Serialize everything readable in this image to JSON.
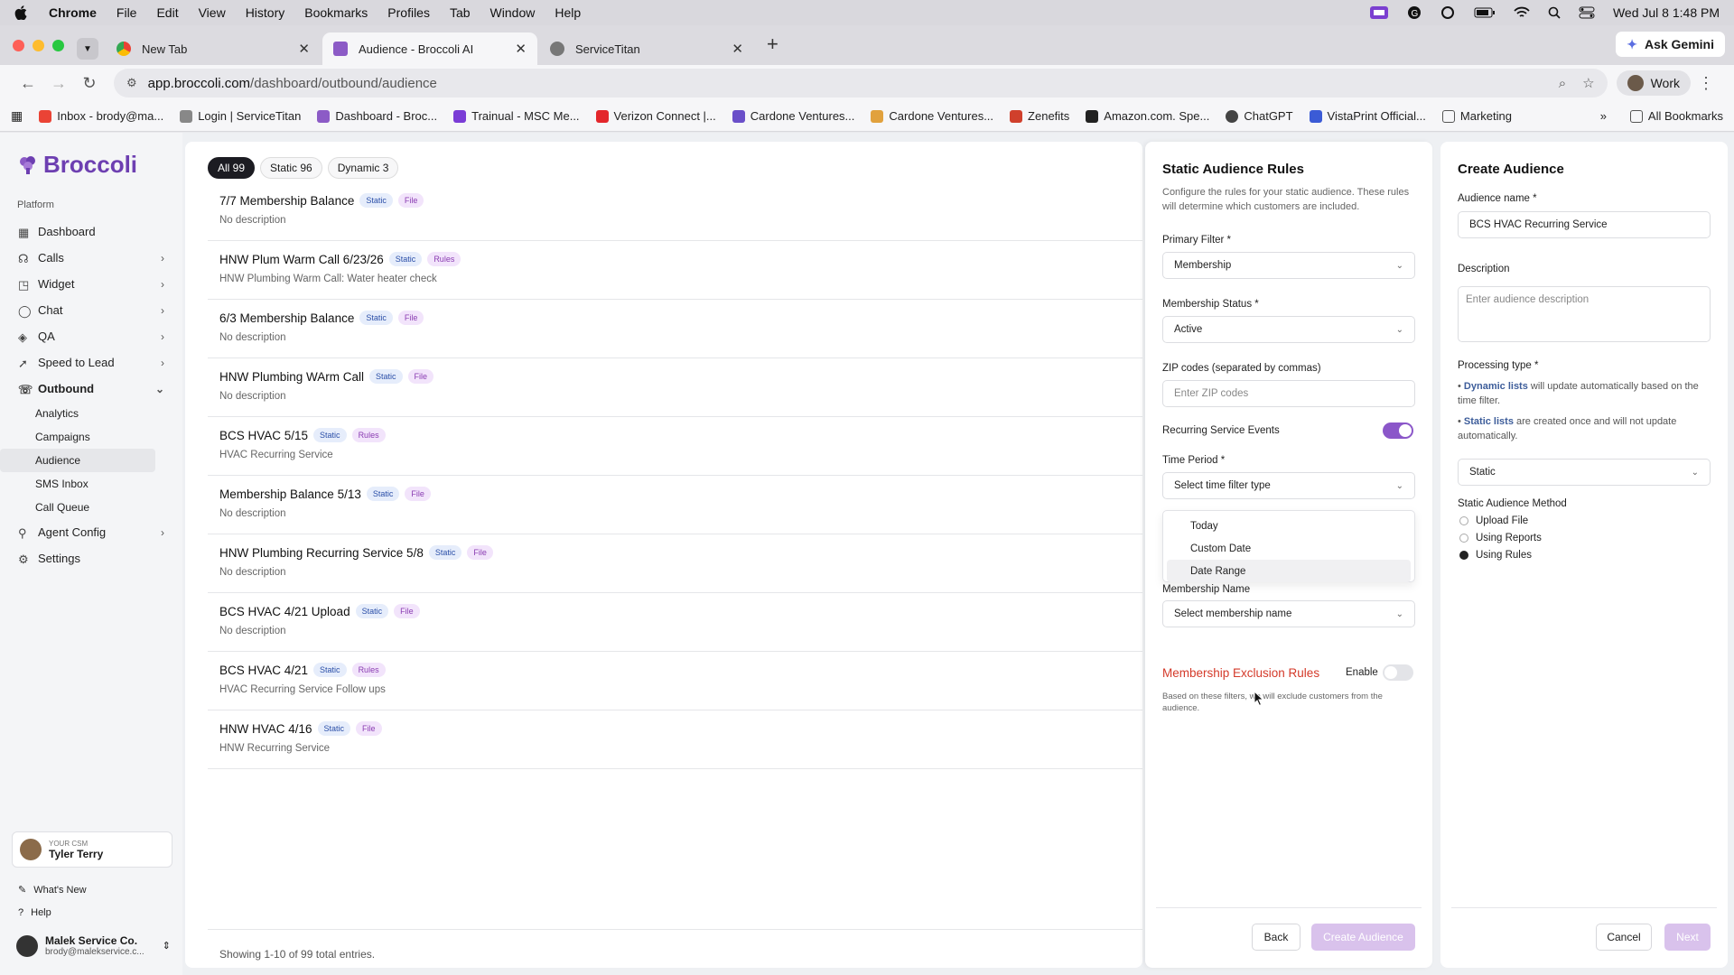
{
  "menubar": {
    "apple": "",
    "items": [
      "Chrome",
      "File",
      "Edit",
      "View",
      "History",
      "Bookmarks",
      "Profiles",
      "Tab",
      "Window",
      "Help"
    ],
    "clock": "Wed Jul 8  1:48 PM"
  },
  "tabs": [
    {
      "title": "New Tab"
    },
    {
      "title": "Audience - Broccoli AI"
    },
    {
      "title": "ServiceTitan"
    }
  ],
  "gemini": "Ask Gemini",
  "address": {
    "host": "app.broccoli.com",
    "path": "/dashboard/outbound/audience"
  },
  "profile": "Work",
  "bookmarks": [
    "Inbox - brody@ma...",
    "Login | ServiceTitan",
    "Dashboard - Broc...",
    "Trainual - MSC Me...",
    "Verizon Connect |...",
    "Cardone Ventures...",
    "Cardone Ventures...",
    "Zenefits",
    "Amazon.com. Spe...",
    "ChatGPT",
    "VistaPrint Official...",
    "Marketing"
  ],
  "all_bookmarks": "All Bookmarks",
  "sidebar": {
    "logo": "Broccoli",
    "section": "Platform",
    "items": [
      {
        "label": "Dashboard"
      },
      {
        "label": "Calls"
      },
      {
        "label": "Widget"
      },
      {
        "label": "Chat"
      },
      {
        "label": "QA"
      },
      {
        "label": "Speed to Lead"
      },
      {
        "label": "Outbound"
      }
    ],
    "outbound_sub": [
      "Analytics",
      "Campaigns",
      "Audience",
      "SMS Inbox",
      "Call Queue"
    ],
    "items_after": [
      {
        "label": "Agent Config"
      },
      {
        "label": "Settings"
      }
    ],
    "csm_label": "YOUR CSM",
    "csm_name": "Tyler Terry",
    "whats_new": "What's New",
    "help": "Help",
    "account_name": "Malek Service Co.",
    "account_email": "brody@malekservice.c..."
  },
  "filters": [
    "All 99",
    "Static 96",
    "Dynamic 3"
  ],
  "audiences": [
    {
      "name": "7/7 Membership Balance",
      "type": "Static",
      "source": "File",
      "desc": "No description"
    },
    {
      "name": "HNW Plum Warm Call 6/23/26",
      "type": "Static",
      "source": "Rules",
      "desc": "HNW Plumbing Warm Call: Water heater check"
    },
    {
      "name": "6/3 Membership Balance",
      "type": "Static",
      "source": "File",
      "desc": "No description"
    },
    {
      "name": "HNW Plumbing WArm Call",
      "type": "Static",
      "source": "File",
      "desc": "No description"
    },
    {
      "name": "BCS HVAC 5/15",
      "type": "Static",
      "source": "Rules",
      "desc": "HVAC Recurring Service"
    },
    {
      "name": "Membership Balance 5/13",
      "type": "Static",
      "source": "File",
      "desc": "No description"
    },
    {
      "name": "HNW Plumbing Recurring Service 5/8",
      "type": "Static",
      "source": "File",
      "desc": "No description"
    },
    {
      "name": "BCS HVAC 4/21 Upload",
      "type": "Static",
      "source": "File",
      "desc": "No description"
    },
    {
      "name": "BCS HVAC 4/21",
      "type": "Static",
      "source": "Rules",
      "desc": "HVAC Recurring Service Follow ups"
    },
    {
      "name": "HNW HVAC 4/16",
      "type": "Static",
      "source": "File",
      "desc": "HNW Recurring Service"
    }
  ],
  "showing": "Showing 1-10 of 99 total entries.",
  "rules_panel": {
    "title": "Static Audience Rules",
    "desc": "Configure the rules for your static audience. These rules will determine which customers are included.",
    "primary_filter_label": "Primary Filter *",
    "primary_filter_value": "Membership",
    "membership_status_label": "Membership Status *",
    "membership_status_value": "Active",
    "zip_label": "ZIP codes (separated by commas)",
    "zip_placeholder": "Enter ZIP codes",
    "recurring_label": "Recurring Service Events",
    "recurring_on": true,
    "time_period_label": "Time Period *",
    "time_period_placeholder": "Select time filter type",
    "time_options": [
      "Today",
      "Custom Date",
      "Date Range"
    ],
    "hovered_option": "Date Range",
    "membership_name_label": "Membership Name",
    "membership_name_placeholder": "Select membership name",
    "exclusion_title": "Membership Exclusion Rules",
    "exclusion_enable": "Enable",
    "exclusion_on": false,
    "exclusion_desc": "Based on these filters, we will exclude customers from the audience.",
    "back": "Back",
    "create": "Create Audience"
  },
  "create_panel": {
    "title": "Create Audience",
    "name_label": "Audience name *",
    "name_value": "BCS HVAC Recurring Service",
    "desc_label": "Description",
    "desc_placeholder": "Enter audience description",
    "processing_label": "Processing type *",
    "dynamic_bold": "Dynamic lists",
    "dynamic_text": " will update automatically based on the time filter.",
    "static_bold": "Static lists",
    "static_text": " are created once and will not update automatically.",
    "processing_value": "Static",
    "method_label": "Static Audience Method",
    "methods": [
      "Upload File",
      "Using Reports",
      "Using Rules"
    ],
    "selected_method": "Using Rules",
    "cancel": "Cancel",
    "next": "Next"
  },
  "colors": {
    "brand": "#6d3fb1",
    "toggle_on": "#8b57c9",
    "exclusion": "#d43a2a"
  }
}
